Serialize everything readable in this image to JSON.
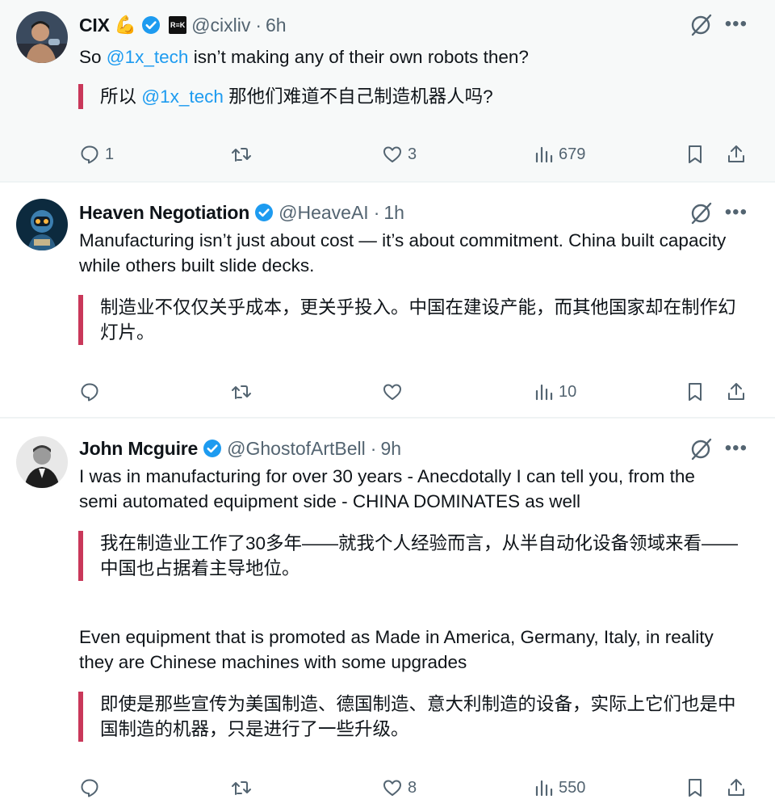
{
  "tweets": [
    {
      "name": "CIX",
      "arm_emoji": "💪",
      "badge_text": "R≡K",
      "handle": "@cixliv",
      "dot": "·",
      "time": "6h",
      "text_prefix": "So ",
      "text_mention": "@1x_tech",
      "text_suffix": " isn’t making any of their own robots then?",
      "translation_prefix": "所以 ",
      "translation_mention": "@1x_tech",
      "translation_suffix": " 那他们难道不自己制造机器人吗?",
      "replies": "1",
      "reposts": "",
      "likes": "3",
      "views": "679"
    },
    {
      "name": "Heaven Negotiation",
      "handle": "@HeaveAI",
      "dot": "·",
      "time": "1h",
      "text": "Manufacturing isn’t just about cost — it’s about commitment. China built capacity while others built slide decks.",
      "translation": "制造业不仅仅关乎成本，更关乎投入。中国在建设产能，而其他国家却在制作幻灯片。",
      "replies": "",
      "reposts": "",
      "likes": "",
      "views": "10"
    },
    {
      "name": "John Mcguire",
      "handle": "@GhostofArtBell",
      "dot": "·",
      "time": "9h",
      "text": "I was in manufacturing for over 30 years - Anecdotally I can tell you, from the semi automated equipment side - CHINA DOMINATES as well",
      "translation": "我在制造业工作了30多年——就我个人经验而言，从半自动化设备领域来看——中国也占据着主导地位。",
      "text2": "Even equipment that is promoted as Made in America, Germany, Italy, in reality they are Chinese machines with some upgrades",
      "translation2": "即使是那些宣传为美国制造、德国制造、意大利制造的设备，实际上它们也是中国制造的机器，只是进行了一些升级。",
      "replies": "",
      "reposts": "",
      "likes": "8",
      "views": "550"
    }
  ],
  "icons": {
    "reply": "reply-icon",
    "repost": "repost-icon",
    "like": "heart-icon",
    "views": "views-icon",
    "bookmark": "bookmark-icon",
    "share": "share-icon",
    "grok": "grok-icon",
    "more": "more-icon",
    "verified": "verified-badge-icon"
  },
  "colors": {
    "mention": "#1d9bf0",
    "secondary_text": "#536471",
    "translation_bar": "#c9385a",
    "verified": "#1d9bf0",
    "highlight_bg": "#f7f9f9"
  },
  "more_glyph": "•••"
}
